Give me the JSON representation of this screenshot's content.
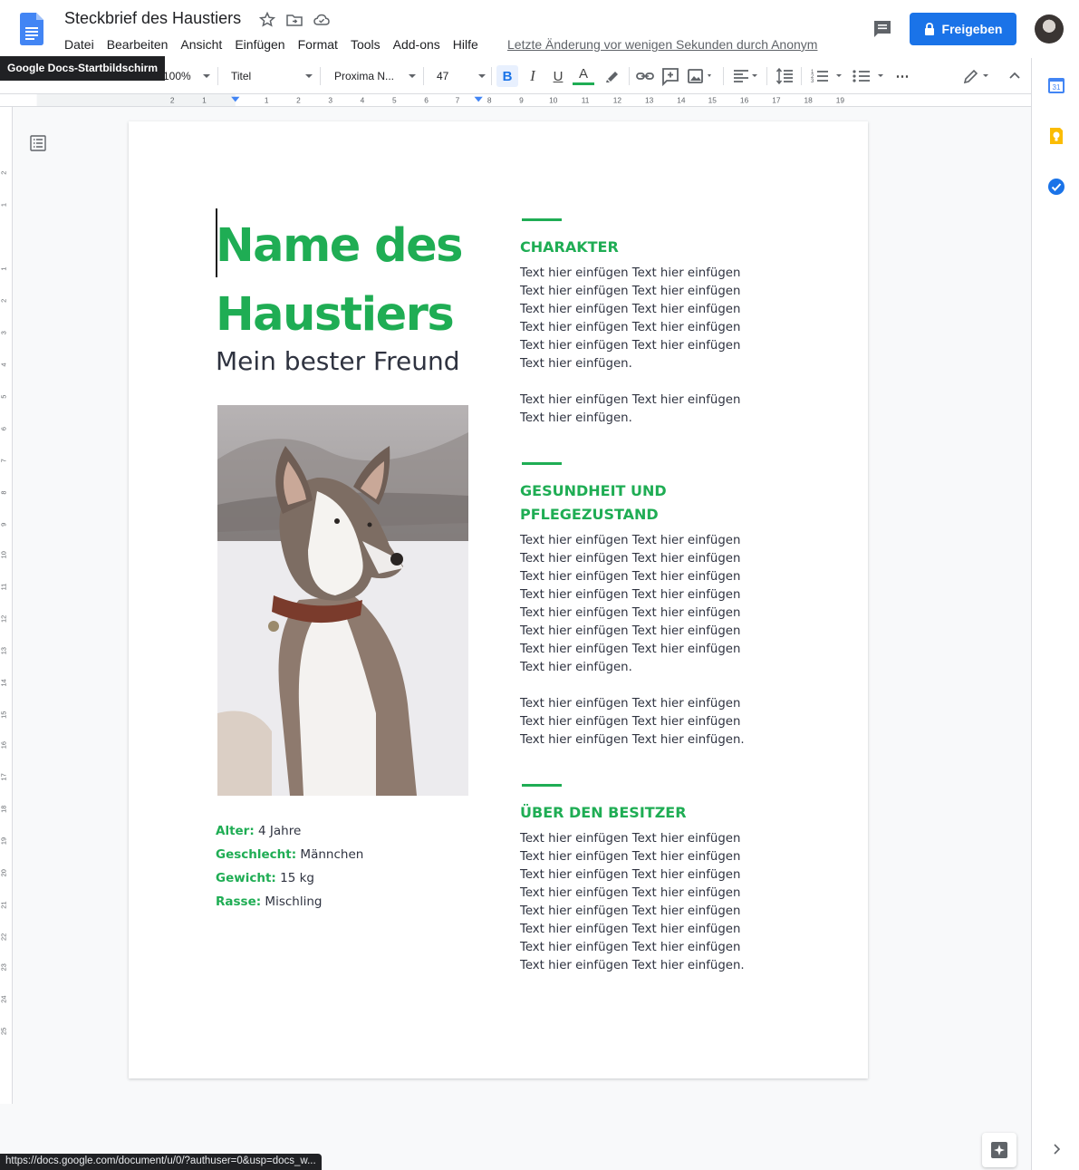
{
  "header": {
    "doc_title": "Steckbrief des Haustiers",
    "menu": [
      "Datei",
      "Bearbeiten",
      "Ansicht",
      "Einfügen",
      "Format",
      "Tools",
      "Add-ons",
      "Hilfe"
    ],
    "last_edit": "Letzte Änderung vor wenigen Sekunden durch Anonym",
    "share_label": "Freigeben",
    "tooltip": "Google Docs-Startbildschirm"
  },
  "toolbar": {
    "zoom": "100%",
    "style": "Titel",
    "font": "Proxima N...",
    "font_size": "47",
    "bold_label": "B",
    "italic_label": "I",
    "underline_label": "U",
    "text_color_label": "A",
    "more_label": "⋯"
  },
  "ruler": {
    "h_ticks": [
      "2",
      "1",
      "1",
      "2",
      "3",
      "4",
      "5",
      "6",
      "7",
      "8",
      "9",
      "10",
      "11",
      "12",
      "13",
      "14",
      "15",
      "16",
      "17",
      "18",
      "19"
    ],
    "v_ticks": [
      "2",
      "1",
      "1",
      "2",
      "3",
      "4",
      "5",
      "6",
      "7",
      "8",
      "9",
      "10",
      "11",
      "12",
      "13",
      "14",
      "15",
      "16",
      "17",
      "18",
      "19",
      "20",
      "21",
      "22",
      "23",
      "24",
      "25"
    ]
  },
  "document": {
    "title_line1": "Name des",
    "title_line2": "Haustiers",
    "subtitle": "Mein bester Freund",
    "facts": [
      {
        "label": "Alter:",
        "value": " 4 Jahre"
      },
      {
        "label": "Geschlecht:",
        "value": " Männchen"
      },
      {
        "label": "Gewicht:",
        "value": " 15 kg"
      },
      {
        "label": "Rasse:",
        "value": " Mischling"
      }
    ],
    "sections": [
      {
        "heading": "CHARAKTER",
        "paragraphs": [
          "Text hier einfügen Text hier einfügen Text hier einfügen Text hier einfügen Text hier einfügen Text hier einfügen Text hier einfügen Text hier einfügen Text hier einfügen Text hier einfügen Text hier einfügen.",
          "Text hier einfügen Text hier einfügen Text hier einfügen."
        ]
      },
      {
        "heading": "GESUNDHEIT UND PFLEGEZUSTAND",
        "paragraphs": [
          "Text hier einfügen Text hier einfügen Text hier einfügen Text hier einfügen Text hier einfügen Text hier einfügen Text hier einfügen Text hier einfügen Text hier einfügen Text hier einfügen Text hier einfügen Text hier einfügen Text hier einfügen Text hier einfügen Text hier einfügen.",
          "Text hier einfügen Text hier einfügen Text hier einfügen Text hier einfügen Text hier einfügen Text hier einfügen."
        ]
      },
      {
        "heading": "ÜBER DEN BESITZER",
        "paragraphs": [
          "Text hier einfügen Text hier einfügen Text hier einfügen Text hier einfügen Text hier einfügen Text hier einfügen Text hier einfügen Text hier einfügen Text hier einfügen Text hier einfügen Text hier einfügen Text hier einfügen Text hier einfügen Text hier einfügen Text hier einfügen Text hier einfügen."
        ]
      }
    ]
  },
  "status_url": "https://docs.google.com/document/u/0/?authuser=0&usp=docs_w...",
  "colors": {
    "accent_green": "#1fad54",
    "share_blue": "#1a73e8",
    "body_text": "#2f3340"
  }
}
